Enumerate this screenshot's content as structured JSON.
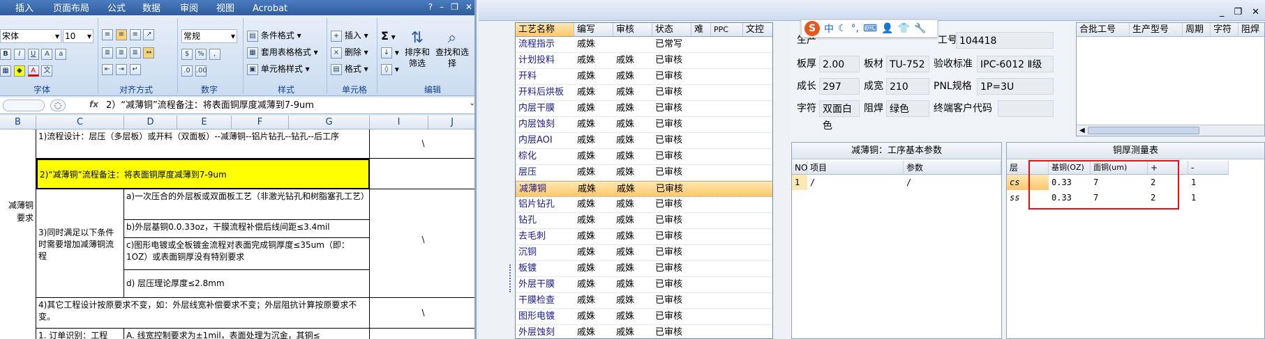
{
  "excel": {
    "tabs": [
      "插入",
      "页面布局",
      "公式",
      "数据",
      "审阅",
      "视图",
      "Acrobat"
    ],
    "font": {
      "name": "宋体",
      "size": "10"
    },
    "number_format": "常规",
    "groups": [
      "字体",
      "对齐方式",
      "数字",
      "样式",
      "单元格",
      "编辑"
    ],
    "style_buttons": [
      "条件格式",
      "套用表格格式",
      "单元格样式"
    ],
    "cell_buttons": [
      "插入",
      "删除",
      "格式"
    ],
    "edit_buttons": [
      "排序和筛选",
      "查找和选择"
    ],
    "formula": "2）“减薄铜”流程备注：将表面铜厚度减薄到7-9um",
    "columns": [
      "B",
      "C",
      "D",
      "E",
      "F",
      "G",
      "I",
      "J"
    ],
    "cells": {
      "c1": "1)流程设计：层压（多层板）或开料（双面板）--减薄铜--铝片钻孔--钻孔--后工序",
      "c2": "2)“减薄铜”流程备注：将表面铜厚度减薄到7-9um",
      "b_side": "减薄铜\n要求",
      "c3": "3)同时满足以下条件时需要增加减薄铜流程",
      "d1": "a)一次压合的外层板或双面板工艺（非激光钻孔和树脂塞孔工艺）",
      "d2": "b)外层基铜0.0.33oz，干膜流程补偿后线间距≤3.4mil",
      "d3": "c)图形电镀或全板镀金流程对表面完成铜厚度≤35um（即：1OZ）或表面铜厚没有特别要求",
      "d4": "d) 层压理论厚度≤2.8mm",
      "c4": "4)其它工程设计按原要求不变，如：外层线宽补偿要求不变；外层阻抗计算按原要求不变。",
      "c5": "1. 订单识别：工程",
      "d5": "A. 线宽控制要求为±1mil，表面处理为沉金，其铜≤",
      "slash": "\\"
    }
  },
  "app": {
    "proc_headers": [
      "工艺名称",
      "编写",
      "审核",
      "状态",
      "难",
      "PPC",
      "文控"
    ],
    "proc_rows": [
      [
        "流程指示",
        "戚姝",
        "",
        "已常写"
      ],
      [
        "计划投料",
        "戚姝",
        "戚姝",
        "已审核"
      ],
      [
        "开料",
        "戚姝",
        "戚姝",
        "已审核"
      ],
      [
        "开料后烘板",
        "戚姝",
        "戚姝",
        "已审核"
      ],
      [
        "内层干膜",
        "戚姝",
        "戚姝",
        "已审核"
      ],
      [
        "内层蚀刻",
        "戚姝",
        "戚姝",
        "已审核"
      ],
      [
        "内层AOI",
        "戚姝",
        "戚姝",
        "已审核"
      ],
      [
        "棕化",
        "戚姝",
        "戚姝",
        "已审核"
      ],
      [
        "层压",
        "戚姝",
        "戚姝",
        "已审核"
      ],
      [
        "减薄铜",
        "戚姝",
        "戚姝",
        "已审核"
      ],
      [
        "铝片钻孔",
        "戚姝",
        "戚姝",
        "已审核"
      ],
      [
        "钻孔",
        "戚姝",
        "戚姝",
        "已审核"
      ],
      [
        "去毛刺",
        "戚姝",
        "戚姝",
        "已审核"
      ],
      [
        "沉铜",
        "戚姝",
        "戚姝",
        "已审核"
      ],
      [
        "板镀",
        "戚姝",
        "戚姝",
        "已审核"
      ],
      [
        "外层干膜",
        "戚姝",
        "戚姝",
        "已审核"
      ],
      [
        "干膜检查",
        "戚姝",
        "戚姝",
        "已审核"
      ],
      [
        "图形电镀",
        "戚姝",
        "戚姝",
        "已审核"
      ],
      [
        "外层蚀刻",
        "戚姝",
        "戚姝",
        "已审核"
      ]
    ],
    "info": {
      "prod_label": "生产",
      "eng_label": "工号",
      "eng_no": "104418",
      "thick_label": "板厚",
      "thick": "2.00",
      "mat_label": "板材",
      "mat": "TU-752",
      "std_label": "验收标准",
      "std": "IPC-6012 Ⅱ级",
      "len_label": "成长",
      "len": "297",
      "wid_label": "成宽",
      "wid": "210",
      "pnl_label": "PNL规格",
      "pnl": "1P=3U",
      "char_label": "字符",
      "char": "双面白色",
      "mask_label": "阻焊",
      "mask": "绿色",
      "cust_label": "终端客户代码",
      "cust": ""
    },
    "ime": {
      "logo": "S",
      "lang": "中"
    },
    "lot_headers": [
      "合批工号",
      "生产型号",
      "周期",
      "字符",
      "阻焊"
    ],
    "params": {
      "title": "减薄铜：工序基本参数",
      "headers": [
        "NO",
        "项目",
        "参数"
      ],
      "row": [
        "1",
        "/",
        "/"
      ]
    },
    "meas": {
      "title": "铜厚测量表",
      "headers": [
        "层",
        "基铜(OZ)",
        "面铜(um)",
        "+",
        "-"
      ],
      "rows": [
        [
          "cs",
          "0.33",
          "7",
          "2",
          "1"
        ],
        [
          "ss",
          "0.33",
          "7",
          "2",
          "1"
        ]
      ]
    }
  }
}
